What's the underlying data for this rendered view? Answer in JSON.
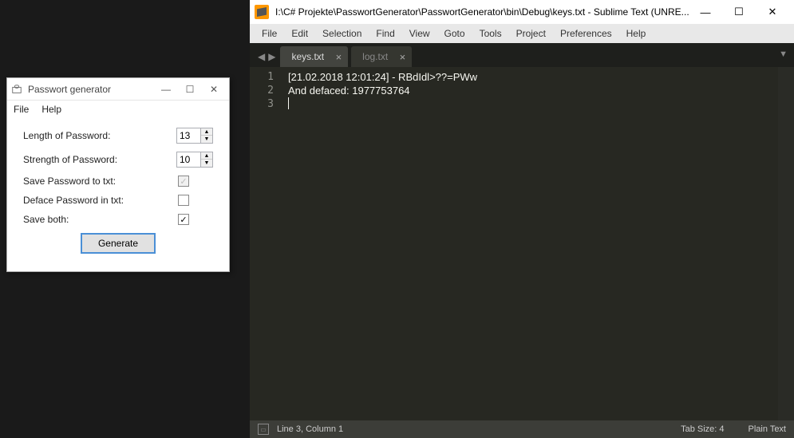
{
  "pwgen": {
    "title": "Passwort generator",
    "menu": {
      "file": "File",
      "help": "Help"
    },
    "labels": {
      "length": "Length of Password:",
      "strength": "Strength of Password:",
      "save_txt": "Save Password to txt:",
      "deface": "Deface Password in txt:",
      "save_both": "Save both:"
    },
    "values": {
      "length": "13",
      "strength": "10"
    },
    "checks": {
      "save_txt": "✓",
      "deface": "",
      "save_both": "✓"
    },
    "generate": "Generate"
  },
  "sublime": {
    "title": "I:\\C# Projekte\\PasswortGenerator\\PasswortGenerator\\bin\\Debug\\keys.txt - Sublime Text (UNRE...",
    "menu": [
      "File",
      "Edit",
      "Selection",
      "Find",
      "View",
      "Goto",
      "Tools",
      "Project",
      "Preferences",
      "Help"
    ],
    "tabs": [
      {
        "name": "keys.txt",
        "active": true
      },
      {
        "name": "log.txt",
        "active": false
      }
    ],
    "lines": [
      "[21.02.2018 12:01:24] - RBdIdl>??=PWw",
      "And defaced: 1977753764",
      ""
    ],
    "line_numbers": [
      "1",
      "2",
      "3"
    ],
    "status": {
      "pos": "Line 3, Column 1",
      "tabsize": "Tab Size: 4",
      "syntax": "Plain Text"
    }
  }
}
